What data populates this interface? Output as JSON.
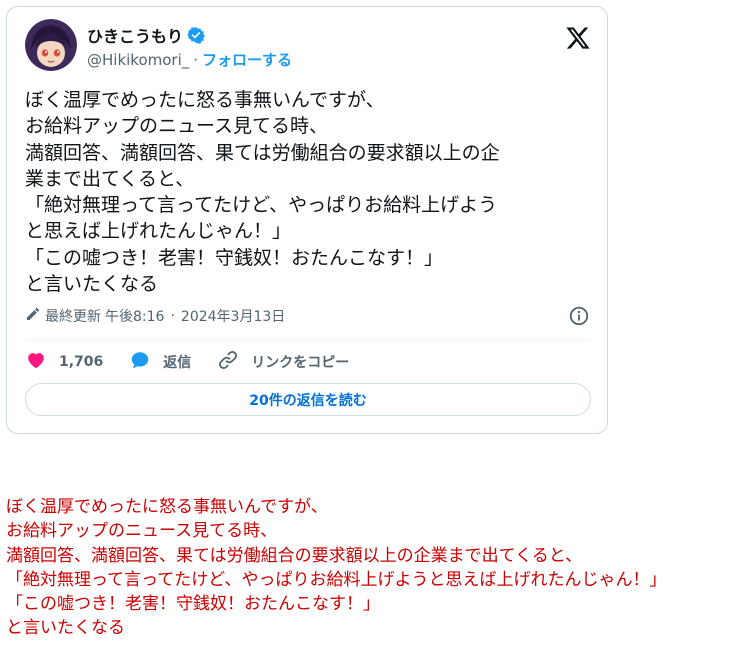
{
  "tweet": {
    "display_name": "ひきこうもり",
    "handle": "@Hikikomori_",
    "separator": "·",
    "follow_label": "フォローする",
    "text_lines": [
      "ぼく温厚でめったに怒る事無いんですが、",
      "お給料アップのニュース見てる時、",
      "満額回答、満額回答、果ては労働組合の要求額以上の企",
      "業まで出てくると、",
      "「絶対無理って言ってたけど、やっぱりお給料上げよう",
      "と思えば上げれたんじゃん！」",
      "「この嘘つき！老害！守銭奴！おたんこなす！」",
      "と言いたくなる"
    ],
    "updated_label": "最終更新",
    "time": "午後8:16",
    "dot": "·",
    "date": "2024年3月13日",
    "likes": "1,706",
    "reply_label": "返信",
    "copy_link_label": "リンクをコピー",
    "read_replies_label": "20件の返信を読む"
  },
  "quote": {
    "lines": [
      "ぼく温厚でめったに怒る事無いんですが、",
      "お給料アップのニュース見てる時、",
      "満額回答、満額回答、果ては労働組合の要求額以上の企業まで出てくると、",
      "「絶対無理って言ってたけど、やっぱりお給料上げようと思えば上げれたんじゃん！」",
      "「この嘘つき！老害！守銭奴！おたんこなす！」",
      "と言いたくなる"
    ]
  },
  "icons": {
    "logo": "x-logo-icon",
    "verified": "verified-badge-icon",
    "edit": "pencil-icon",
    "info": "info-icon",
    "like": "heart-icon",
    "reply": "speech-bubble-icon",
    "link": "link-icon"
  },
  "colors": {
    "accent": "#1d9bf0",
    "like": "#f91880",
    "text": "#0f1419",
    "muted": "#536471",
    "quote_text": "#cc0000"
  }
}
